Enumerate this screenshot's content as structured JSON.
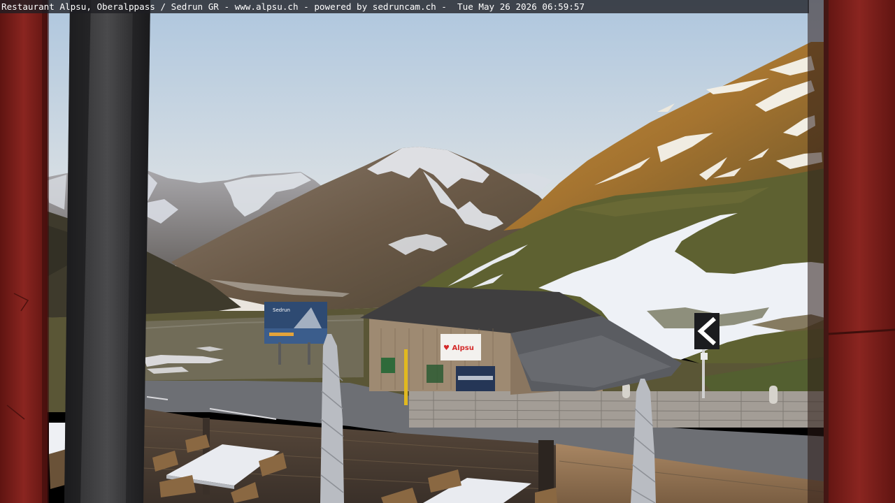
{
  "overlay": {
    "caption": "Restaurant Alpsu, Oberalppass / Sedrun GR - www.alpsu.ch - powered by sedruncam.ch -  Tue May 26 2026 06:59:57"
  },
  "scene": {
    "building_sign": "♥ Alpsu",
    "billboard_title": "Sedrun"
  },
  "colors": {
    "sky_top": "#b8cde0",
    "sky_bottom": "#e3e6e4",
    "sunlit_slope": "#b07e36",
    "snow": "#eef1f6",
    "grass": "#5e6131",
    "frame_red": "#7d1f1a",
    "road": "#6d6f74",
    "roof": "#3f3e3f",
    "wall": "#9e8a72",
    "sign_red": "#d42a2a"
  }
}
